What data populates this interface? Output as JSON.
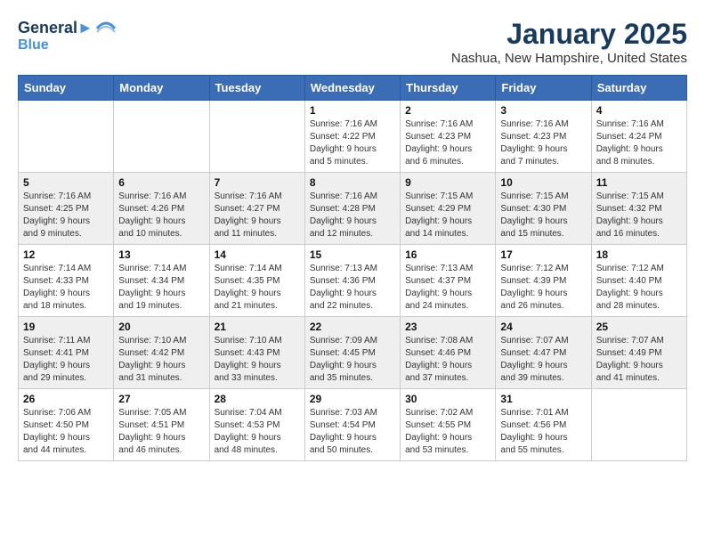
{
  "header": {
    "logo_line1": "General",
    "logo_line2": "Blue",
    "month": "January 2025",
    "location": "Nashua, New Hampshire, United States"
  },
  "weekdays": [
    "Sunday",
    "Monday",
    "Tuesday",
    "Wednesday",
    "Thursday",
    "Friday",
    "Saturday"
  ],
  "weeks": [
    [
      {
        "day": "",
        "info": ""
      },
      {
        "day": "",
        "info": ""
      },
      {
        "day": "",
        "info": ""
      },
      {
        "day": "1",
        "info": "Sunrise: 7:16 AM\nSunset: 4:22 PM\nDaylight: 9 hours\nand 5 minutes."
      },
      {
        "day": "2",
        "info": "Sunrise: 7:16 AM\nSunset: 4:23 PM\nDaylight: 9 hours\nand 6 minutes."
      },
      {
        "day": "3",
        "info": "Sunrise: 7:16 AM\nSunset: 4:23 PM\nDaylight: 9 hours\nand 7 minutes."
      },
      {
        "day": "4",
        "info": "Sunrise: 7:16 AM\nSunset: 4:24 PM\nDaylight: 9 hours\nand 8 minutes."
      }
    ],
    [
      {
        "day": "5",
        "info": "Sunrise: 7:16 AM\nSunset: 4:25 PM\nDaylight: 9 hours\nand 9 minutes."
      },
      {
        "day": "6",
        "info": "Sunrise: 7:16 AM\nSunset: 4:26 PM\nDaylight: 9 hours\nand 10 minutes."
      },
      {
        "day": "7",
        "info": "Sunrise: 7:16 AM\nSunset: 4:27 PM\nDaylight: 9 hours\nand 11 minutes."
      },
      {
        "day": "8",
        "info": "Sunrise: 7:16 AM\nSunset: 4:28 PM\nDaylight: 9 hours\nand 12 minutes."
      },
      {
        "day": "9",
        "info": "Sunrise: 7:15 AM\nSunset: 4:29 PM\nDaylight: 9 hours\nand 14 minutes."
      },
      {
        "day": "10",
        "info": "Sunrise: 7:15 AM\nSunset: 4:30 PM\nDaylight: 9 hours\nand 15 minutes."
      },
      {
        "day": "11",
        "info": "Sunrise: 7:15 AM\nSunset: 4:32 PM\nDaylight: 9 hours\nand 16 minutes."
      }
    ],
    [
      {
        "day": "12",
        "info": "Sunrise: 7:14 AM\nSunset: 4:33 PM\nDaylight: 9 hours\nand 18 minutes."
      },
      {
        "day": "13",
        "info": "Sunrise: 7:14 AM\nSunset: 4:34 PM\nDaylight: 9 hours\nand 19 minutes."
      },
      {
        "day": "14",
        "info": "Sunrise: 7:14 AM\nSunset: 4:35 PM\nDaylight: 9 hours\nand 21 minutes."
      },
      {
        "day": "15",
        "info": "Sunrise: 7:13 AM\nSunset: 4:36 PM\nDaylight: 9 hours\nand 22 minutes."
      },
      {
        "day": "16",
        "info": "Sunrise: 7:13 AM\nSunset: 4:37 PM\nDaylight: 9 hours\nand 24 minutes."
      },
      {
        "day": "17",
        "info": "Sunrise: 7:12 AM\nSunset: 4:39 PM\nDaylight: 9 hours\nand 26 minutes."
      },
      {
        "day": "18",
        "info": "Sunrise: 7:12 AM\nSunset: 4:40 PM\nDaylight: 9 hours\nand 28 minutes."
      }
    ],
    [
      {
        "day": "19",
        "info": "Sunrise: 7:11 AM\nSunset: 4:41 PM\nDaylight: 9 hours\nand 29 minutes."
      },
      {
        "day": "20",
        "info": "Sunrise: 7:10 AM\nSunset: 4:42 PM\nDaylight: 9 hours\nand 31 minutes."
      },
      {
        "day": "21",
        "info": "Sunrise: 7:10 AM\nSunset: 4:43 PM\nDaylight: 9 hours\nand 33 minutes."
      },
      {
        "day": "22",
        "info": "Sunrise: 7:09 AM\nSunset: 4:45 PM\nDaylight: 9 hours\nand 35 minutes."
      },
      {
        "day": "23",
        "info": "Sunrise: 7:08 AM\nSunset: 4:46 PM\nDaylight: 9 hours\nand 37 minutes."
      },
      {
        "day": "24",
        "info": "Sunrise: 7:07 AM\nSunset: 4:47 PM\nDaylight: 9 hours\nand 39 minutes."
      },
      {
        "day": "25",
        "info": "Sunrise: 7:07 AM\nSunset: 4:49 PM\nDaylight: 9 hours\nand 41 minutes."
      }
    ],
    [
      {
        "day": "26",
        "info": "Sunrise: 7:06 AM\nSunset: 4:50 PM\nDaylight: 9 hours\nand 44 minutes."
      },
      {
        "day": "27",
        "info": "Sunrise: 7:05 AM\nSunset: 4:51 PM\nDaylight: 9 hours\nand 46 minutes."
      },
      {
        "day": "28",
        "info": "Sunrise: 7:04 AM\nSunset: 4:53 PM\nDaylight: 9 hours\nand 48 minutes."
      },
      {
        "day": "29",
        "info": "Sunrise: 7:03 AM\nSunset: 4:54 PM\nDaylight: 9 hours\nand 50 minutes."
      },
      {
        "day": "30",
        "info": "Sunrise: 7:02 AM\nSunset: 4:55 PM\nDaylight: 9 hours\nand 53 minutes."
      },
      {
        "day": "31",
        "info": "Sunrise: 7:01 AM\nSunset: 4:56 PM\nDaylight: 9 hours\nand 55 minutes."
      },
      {
        "day": "",
        "info": ""
      }
    ]
  ]
}
